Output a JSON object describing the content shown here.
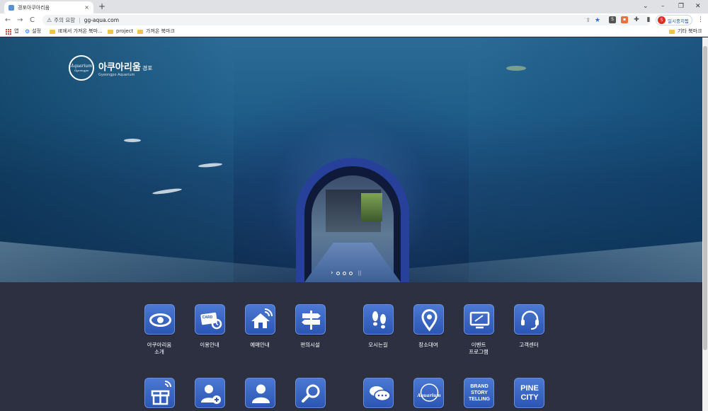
{
  "browser": {
    "tab_title": "경포아쿠아리움",
    "tab_close": "×",
    "new_tab": "+",
    "window_controls": [
      "⌄",
      "–",
      "❐",
      "✕"
    ],
    "nav": {
      "back": "←",
      "forward": "→",
      "reload": "C"
    },
    "security_label": "주의 요함",
    "url": "gg-aqua.com",
    "profile_label": "일시중지됨",
    "profile_initial": "S"
  },
  "bookmarks": {
    "apps": "앱",
    "settings": "설정",
    "items": [
      "IE에서 가져온 북마...",
      "project",
      "가져온 북마크"
    ],
    "other": "기타 북마크"
  },
  "hero": {
    "logo_title": "아쿠아리움",
    "logo_suffix": "경포",
    "logo_en": "Gyeongpo Aquarium",
    "emblem_text": "Aquarium",
    "emblem_sub": "Gyeongpo",
    "slider": {
      "next": "›",
      "pause": "||",
      "dots": 3
    }
  },
  "menu": {
    "row1": [
      {
        "label": "아쿠아리움\n소개",
        "icon": "eye-icon"
      },
      {
        "label": "이용안내",
        "icon": "ticket-card-icon",
        "icon_text": "CARD"
      },
      {
        "label": "예매안내",
        "icon": "home-wifi-icon"
      },
      {
        "label": "편의시설",
        "icon": "signpost-icon"
      },
      {
        "label": "오시는길",
        "icon": "footprints-icon"
      },
      {
        "label": "장소대여",
        "icon": "location-pin-icon"
      },
      {
        "label": "이벤트\n프로그램",
        "icon": "monitor-icon"
      },
      {
        "label": "고객센터",
        "icon": "headset-icon"
      }
    ],
    "row2": [
      {
        "icon": "gift-icon"
      },
      {
        "icon": "add-user-icon"
      },
      {
        "icon": "user-icon"
      },
      {
        "icon": "search-icon"
      },
      {
        "icon": "chat-bubbles-icon"
      },
      {
        "icon": "aquarium-logo-icon",
        "icon_text": "Aquarium"
      },
      {
        "icon": "brand-story-icon",
        "icon_text": [
          "BRAND",
          "STORY",
          "TELLING"
        ]
      },
      {
        "icon": "pine-city-icon",
        "icon_text": [
          "PINE",
          "CITY"
        ]
      }
    ]
  },
  "colors": {
    "button_top": "#4a78d2",
    "button_bottom": "#2c56b4",
    "menu_bg": "#2d3041",
    "bookmark_star": "#1a73e8"
  }
}
